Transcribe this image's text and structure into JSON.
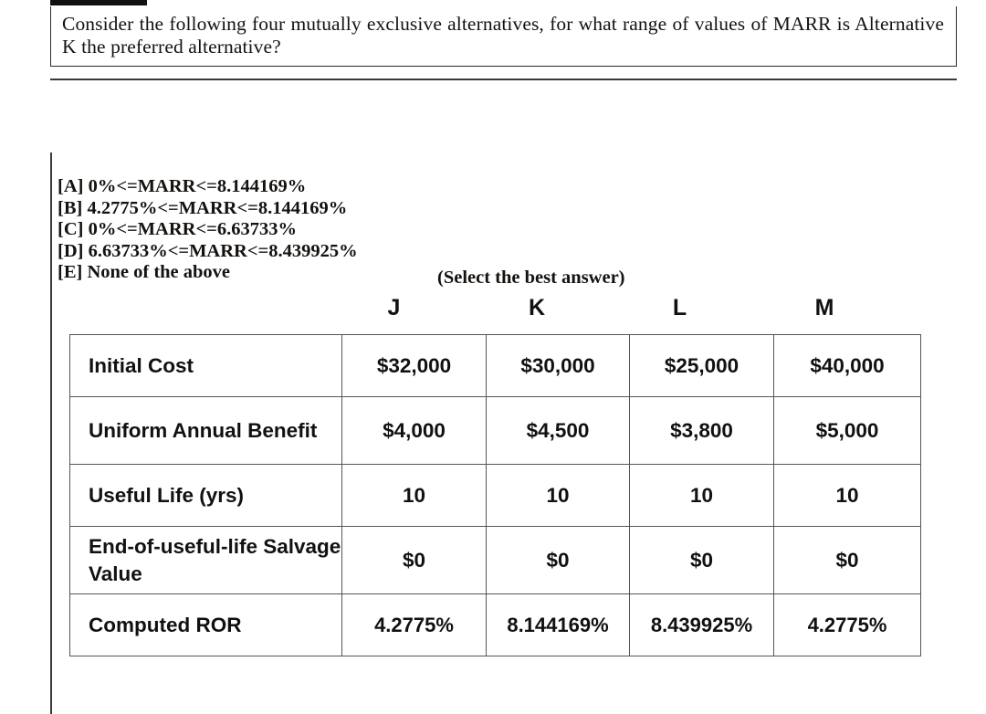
{
  "question": {
    "text": "Consider the following four mutually exclusive alternatives, for what range of values of MARR is Alternative K the preferred alternative?"
  },
  "choices": [
    {
      "tag": "[A]",
      "text": "0%<=MARR<=8.144169%"
    },
    {
      "tag": "[B]",
      "text": "4.2775%<=MARR<=8.144169%"
    },
    {
      "tag": "[C]",
      "text": "0%<=MARR<=6.63733%"
    },
    {
      "tag": "[D]",
      "text": "6.63733%<=MARR<=8.439925%"
    },
    {
      "tag": "[E]",
      "text": "None of the above"
    }
  ],
  "select_note": "(Select the best answer)",
  "table": {
    "columns": [
      "J",
      "K",
      "L",
      "M"
    ],
    "rows": [
      {
        "label": "Initial Cost",
        "values": [
          "$32,000",
          "$30,000",
          "$25,000",
          "$40,000"
        ]
      },
      {
        "label": "Uniform Annual Benefit",
        "values": [
          "$4,000",
          "$4,500",
          "$3,800",
          "$5,000"
        ]
      },
      {
        "label": "Useful Life (yrs)",
        "values": [
          "10",
          "10",
          "10",
          "10"
        ]
      },
      {
        "label": "End-of-useful-life Salvage Value",
        "values": [
          "$0",
          "$0",
          "$0",
          "$0"
        ]
      },
      {
        "label": "Computed ROR",
        "values": [
          "4.2775%",
          "8.144169%",
          "8.439925%",
          "4.2775%"
        ]
      }
    ]
  },
  "colors": {
    "text": "#15120f",
    "rule": "#3a3a3a",
    "table_border": "#555555",
    "bar": "#111111"
  }
}
